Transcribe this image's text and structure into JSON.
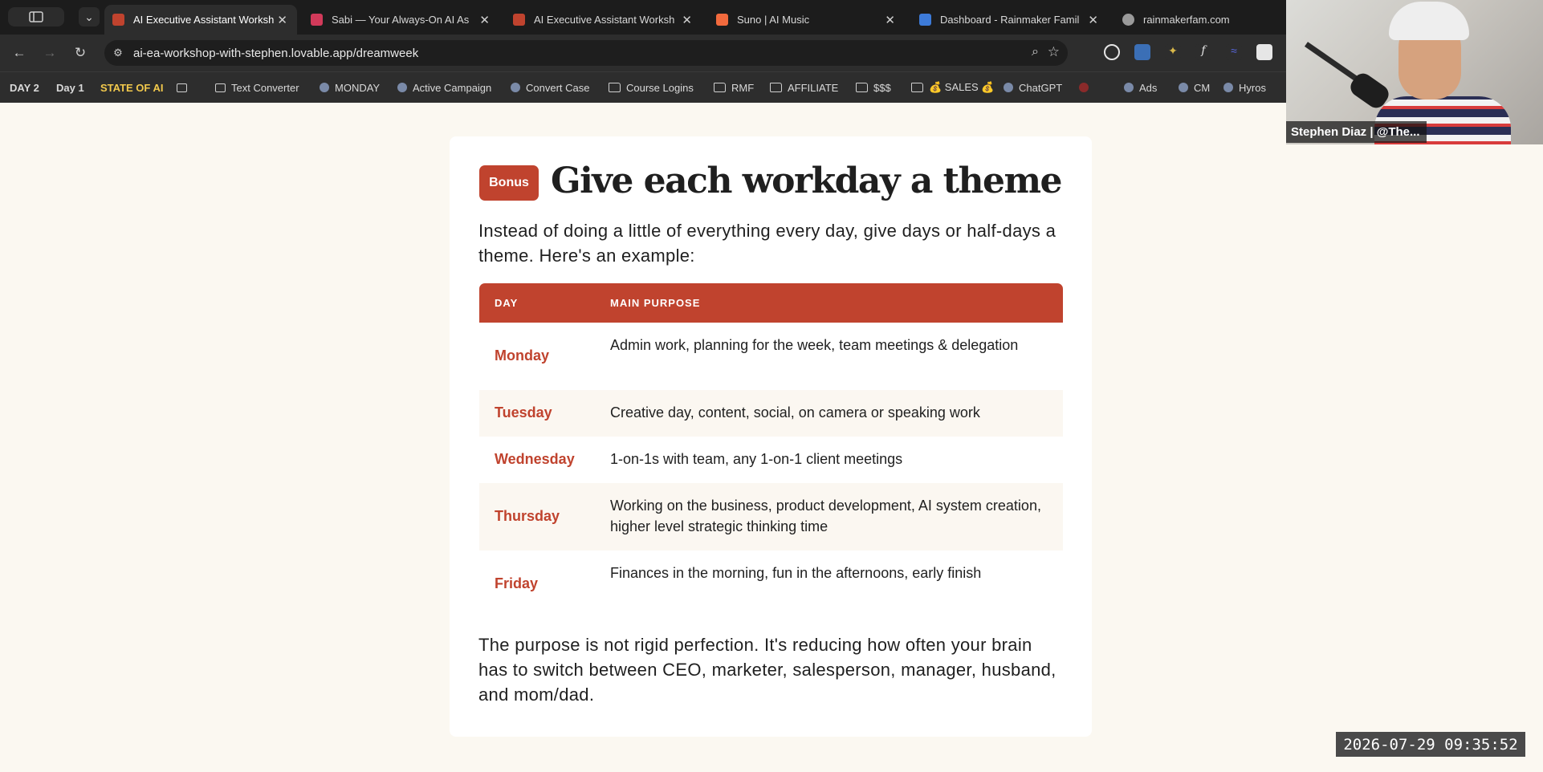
{
  "browser": {
    "tabs": [
      {
        "title": "AI Executive Assistant Worksh",
        "favicon_color": "#c0432e",
        "active": true
      },
      {
        "title": "Sabi — Your Always-On AI As",
        "favicon_color": "#d23a5a",
        "active": false
      },
      {
        "title": "AI Executive Assistant Worksh",
        "favicon_color": "#c0432e",
        "active": false
      },
      {
        "title": "Suno | AI Music",
        "favicon_color": "#f26a3d",
        "active": false
      },
      {
        "title": "Dashboard - Rainmaker Famil",
        "favicon_color": "#3d7bd9",
        "active": false
      },
      {
        "title": "rainmakerfam.com",
        "favicon_color": "#9a9a9a",
        "active": false
      }
    ],
    "close_glyph": "✕",
    "url": "ai-ea-workshop-with-stephen.lovable.app/dreamweek",
    "bookmarks": [
      {
        "label": "DAY 2",
        "icon": "none"
      },
      {
        "label": "Day 1",
        "icon": "none"
      },
      {
        "label": "STATE OF AI",
        "icon": "none"
      },
      {
        "label": "",
        "icon": "grid-icon"
      },
      {
        "label": "Text Converter",
        "icon": "page-icon"
      },
      {
        "label": "MONDAY",
        "icon": "monday-icon"
      },
      {
        "label": "Active Campaign",
        "icon": "arrow-icon"
      },
      {
        "label": "Convert Case",
        "icon": "case-icon"
      },
      {
        "label": "Course Logins",
        "icon": "folder-icon"
      },
      {
        "label": "RMF",
        "icon": "folder-icon"
      },
      {
        "label": "AFFILIATE",
        "icon": "folder-icon"
      },
      {
        "label": "$$$",
        "icon": "folder-icon"
      },
      {
        "label": "💰 SALES 💰",
        "icon": "folder-icon"
      },
      {
        "label": "ChatGPT",
        "icon": "chatgpt-icon"
      },
      {
        "label": "",
        "icon": "red-dropdown-icon"
      },
      {
        "label": "Ads",
        "icon": "meta-icon"
      },
      {
        "label": "CM",
        "icon": "cm-icon"
      },
      {
        "label": "Hyros",
        "icon": "hyros-icon"
      }
    ]
  },
  "webcam": {
    "name": "Stephen Diaz | @The..."
  },
  "page": {
    "badge": "Bonus",
    "title": "Give each workday a theme",
    "intro": "Instead of doing a little of everything every day, give days or half-days a theme. Here's an example:",
    "table": {
      "headers": [
        "DAY",
        "MAIN PURPOSE"
      ],
      "rows": [
        {
          "day": "Monday",
          "purpose": "Admin work, planning for the week, team meetings & delegation"
        },
        {
          "day": "Tuesday",
          "purpose": "Creative day, content, social, on camera or speaking work"
        },
        {
          "day": "Wednesday",
          "purpose": "1-on-1s with team, any 1-on-1 client meetings"
        },
        {
          "day": "Thursday",
          "purpose": "Working on the business, product development, AI system creation, higher level strategic thinking time"
        },
        {
          "day": "Friday",
          "purpose": "Finances in the morning, fun in the afternoons, early finish"
        }
      ]
    },
    "outro": "The purpose is not rigid perfection. It's reducing how often your brain has to switch between CEO, marketer, salesperson, manager, husband, and mom/dad."
  },
  "timestamp": "2026-07-29 09:35:52",
  "colors": {
    "accent": "#c0432e",
    "page_bg": "#fbf8f1",
    "chrome_bg": "#2d2d2d"
  }
}
